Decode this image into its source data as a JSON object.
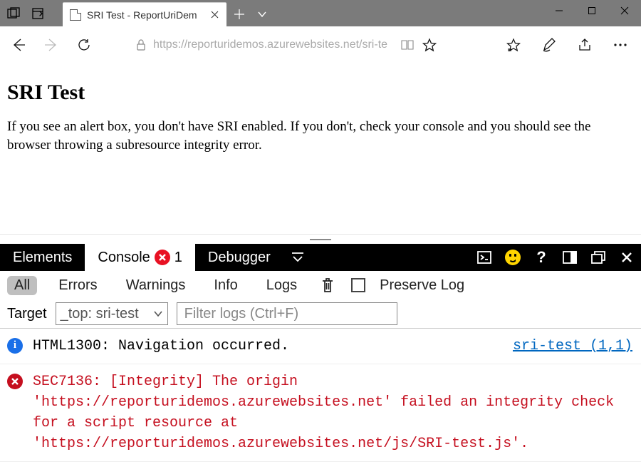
{
  "window": {
    "tab_title": "SRI Test - ReportUriDem"
  },
  "address": {
    "url_display": "https://reporturidemos.azurewebsites.net/sri-te"
  },
  "page": {
    "heading": "SRI Test",
    "paragraph": "If you see an alert box, you don't have SRI enabled. If you don't, check your console and you should see the browser throwing a subresource integrity error."
  },
  "devtools": {
    "tabs": {
      "elements": "Elements",
      "console": "Console",
      "debugger": "Debugger"
    },
    "error_count": "1",
    "filters": {
      "all": "All",
      "errors": "Errors",
      "warnings": "Warnings",
      "info": "Info",
      "logs": "Logs",
      "preserve": "Preserve Log"
    },
    "target": {
      "label": "Target",
      "selected": "_top: sri-test",
      "filter_placeholder": "Filter logs (Ctrl+F)"
    },
    "messages": [
      {
        "kind": "info",
        "text": "HTML1300: Navigation occurred.",
        "source": "sri-test (1,1)"
      },
      {
        "kind": "error",
        "text": "SEC7136: [Integrity] The origin 'https://reporturidemos.azurewebsites.net' failed an integrity check for a script resource at 'https://reporturidemos.azurewebsites.net/js/SRI-test.js'."
      }
    ]
  }
}
